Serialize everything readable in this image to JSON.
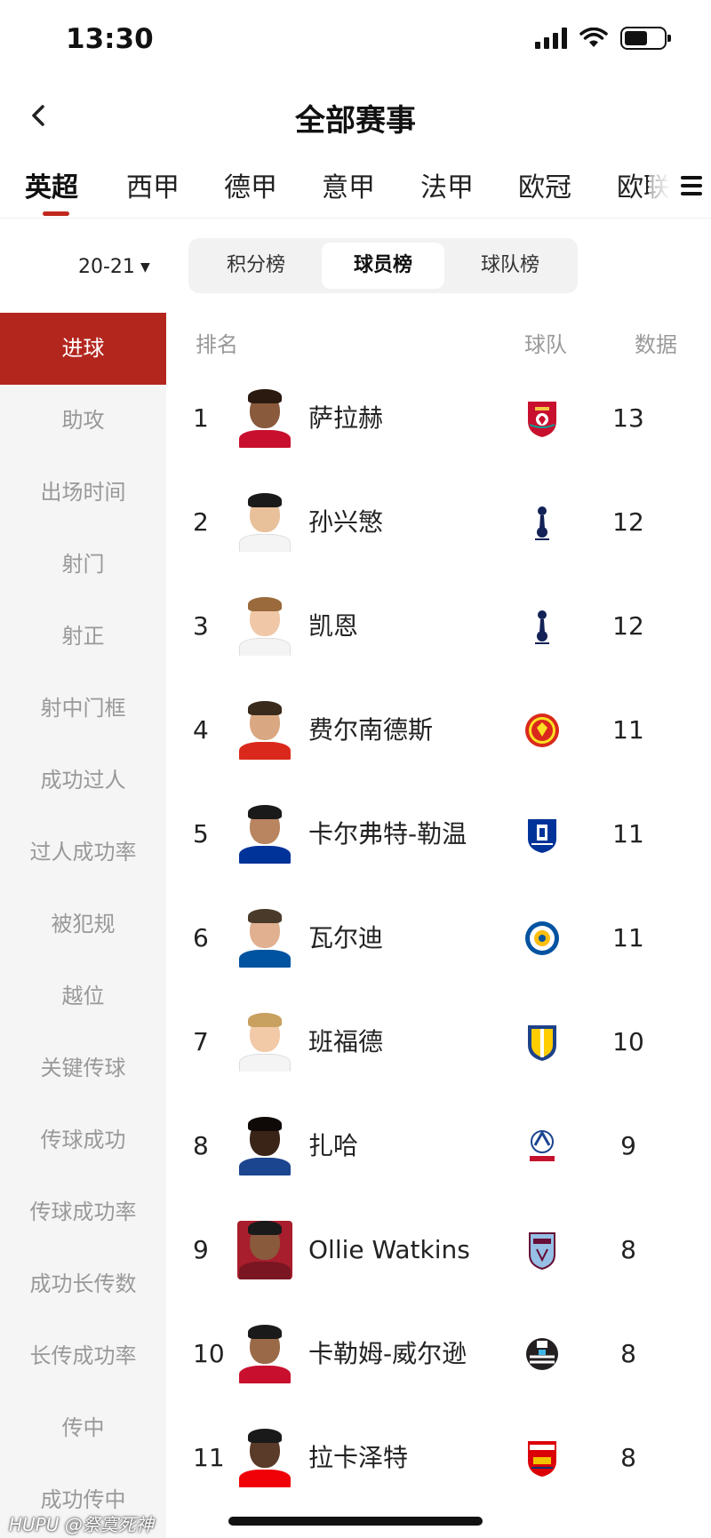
{
  "status": {
    "time": "13:30"
  },
  "nav": {
    "title": "全部赛事"
  },
  "league_tabs": [
    "英超",
    "西甲",
    "德甲",
    "意甲",
    "法甲",
    "欧冠",
    "欧联"
  ],
  "season": "20-21",
  "segments": [
    "积分榜",
    "球员榜",
    "球队榜"
  ],
  "sidebar": [
    "进球",
    "助攻",
    "出场时间",
    "射门",
    "射正",
    "射中门框",
    "成功过人",
    "过人成功率",
    "被犯规",
    "越位",
    "关键传球",
    "传球成功",
    "传球成功率",
    "成功长传数",
    "长传成功率",
    "传中",
    "成功传中"
  ],
  "table": {
    "headers": {
      "rank": "排名",
      "team": "球队",
      "data": "数据"
    },
    "rows": [
      {
        "rank": "1",
        "name": "萨拉赫",
        "value": "13",
        "team_icon": "liverpool-crest"
      },
      {
        "rank": "2",
        "name": "孙兴慜",
        "value": "12",
        "team_icon": "tottenham-crest"
      },
      {
        "rank": "3",
        "name": "凯恩",
        "value": "12",
        "team_icon": "tottenham-crest"
      },
      {
        "rank": "4",
        "name": "费尔南德斯",
        "value": "11",
        "team_icon": "manchester-united-crest"
      },
      {
        "rank": "5",
        "name": "卡尔弗特-勒温",
        "value": "11",
        "team_icon": "everton-crest"
      },
      {
        "rank": "6",
        "name": "瓦尔迪",
        "value": "11",
        "team_icon": "leicester-crest"
      },
      {
        "rank": "7",
        "name": "班福德",
        "value": "10",
        "team_icon": "leeds-crest"
      },
      {
        "rank": "8",
        "name": "扎哈",
        "value": "9",
        "team_icon": "crystal-palace-crest"
      },
      {
        "rank": "9",
        "name": "Ollie Watkins",
        "value": "8",
        "team_icon": "aston-villa-crest"
      },
      {
        "rank": "10",
        "name": "卡勒姆-威尔逊",
        "value": "8",
        "team_icon": "newcastle-crest"
      },
      {
        "rank": "11",
        "name": "拉卡泽特",
        "value": "8",
        "team_icon": "arsenal-crest"
      }
    ]
  },
  "watermark": "HUPU @祭寞死神",
  "colors": {
    "accent": "#b3261e",
    "tab_underline": "#c0281d",
    "muted_text": "#999999",
    "sidebar_bg": "#f5f5f5"
  }
}
